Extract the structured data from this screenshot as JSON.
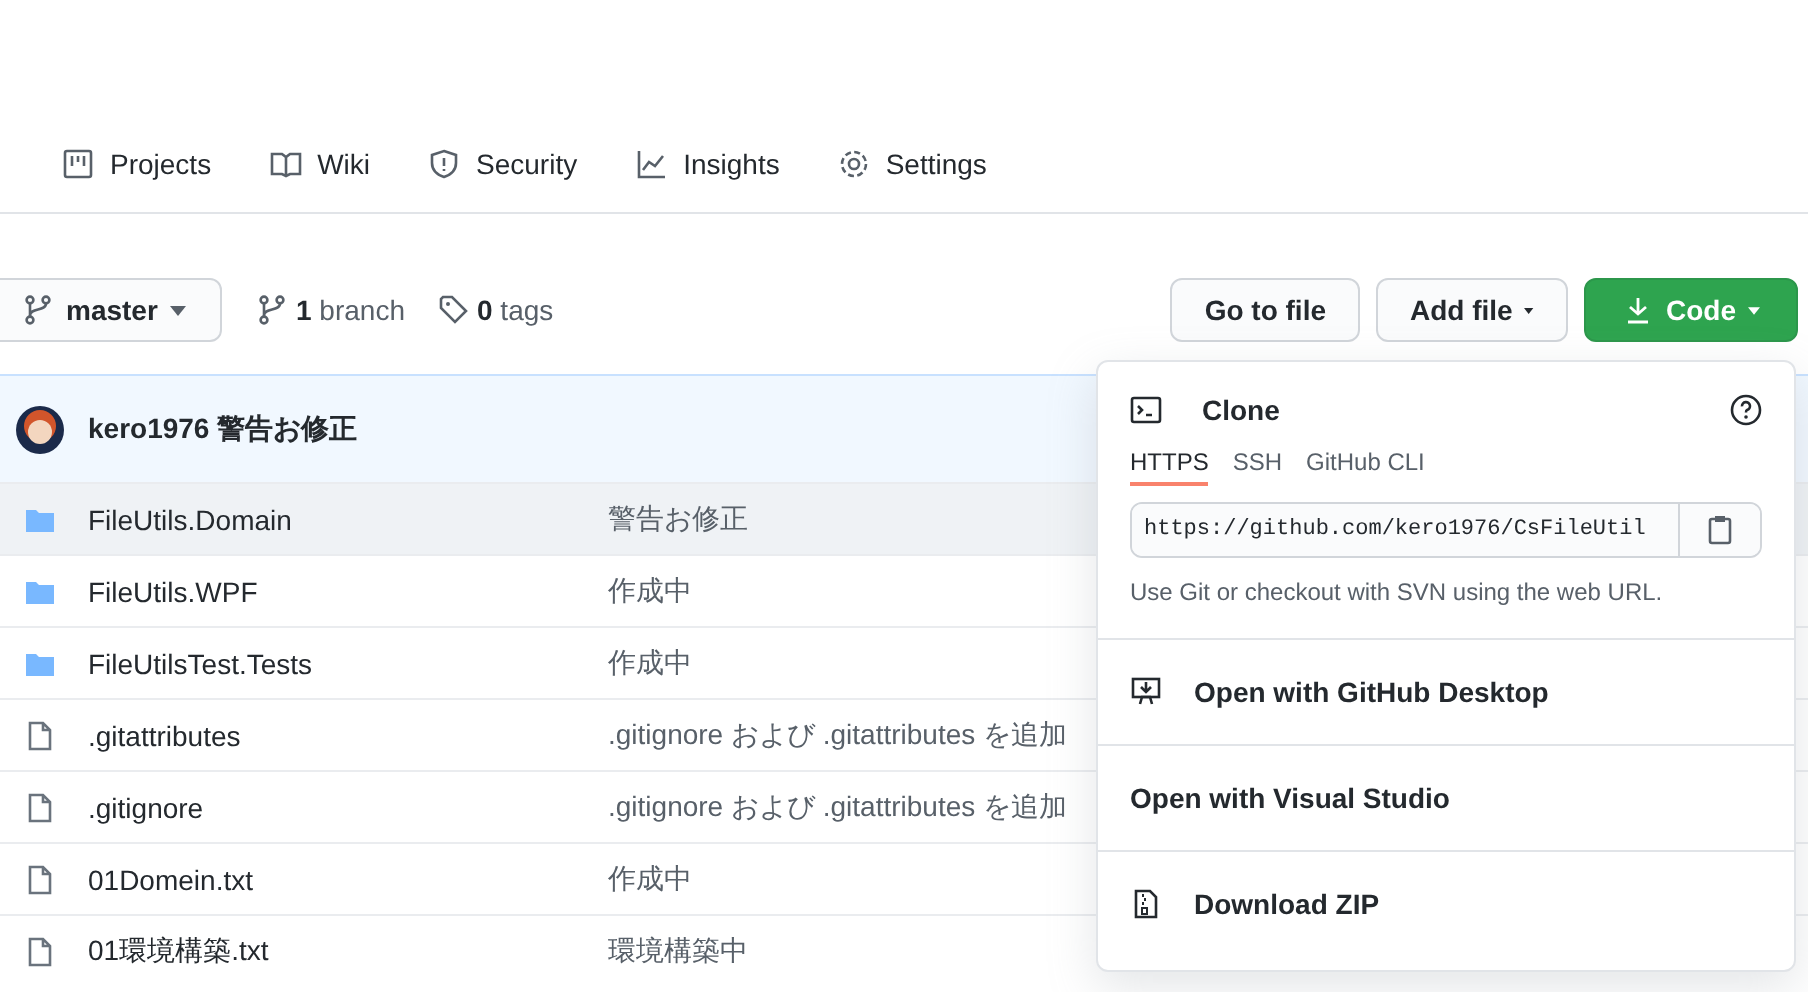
{
  "repo_nav": [
    {
      "label": "Projects",
      "selected": false
    },
    {
      "label": "Wiki",
      "selected": false
    },
    {
      "label": "Security",
      "selected": false
    },
    {
      "label": "Insights",
      "selected": false
    },
    {
      "label": "Settings",
      "selected": false
    }
  ],
  "branch_button": {
    "label": "master"
  },
  "branch_count": {
    "count": "1",
    "label": "branch"
  },
  "tag_count": {
    "count": "0",
    "label": "tags"
  },
  "actions": [
    {
      "label": "Go to file",
      "kind": "plain"
    },
    {
      "label": "Add file",
      "kind": "menu"
    },
    {
      "label": "Code",
      "kind": "primary"
    }
  ],
  "latest_commit": {
    "author": "kero1976",
    "message": "警告お修正"
  },
  "files": [
    {
      "kind": "folder",
      "name": "FileUtils.Domain",
      "message": "警告お修正",
      "selected": true
    },
    {
      "kind": "folder",
      "name": "FileUtils.WPF",
      "message": "作成中",
      "selected": false
    },
    {
      "kind": "folder",
      "name": "FileUtilsTest.Tests",
      "message": "作成中",
      "selected": false
    },
    {
      "kind": "file",
      "name": ".gitattributes",
      "message": ".gitignore および .gitattributes を追加",
      "selected": false
    },
    {
      "kind": "file",
      "name": ".gitignore",
      "message": ".gitignore および .gitattributes を追加",
      "selected": false
    },
    {
      "kind": "file",
      "name": "01Domein.txt",
      "message": "作成中",
      "selected": false
    },
    {
      "kind": "file",
      "name": "01環境構築.txt",
      "message": "環境構築中",
      "selected": false
    }
  ],
  "code_menu": {
    "title": "Clone",
    "tabs": [
      {
        "label": "HTTPS",
        "selected": true
      },
      {
        "label": "SSH",
        "selected": false
      },
      {
        "label": "GitHub CLI",
        "selected": false
      }
    ],
    "url": "https://github.com/kero1976/CsFileUtil",
    "hint": "Use Git or checkout with SVN using the web URL.",
    "items": [
      {
        "label": "Open with GitHub Desktop"
      },
      {
        "label": "Open with Visual Studio"
      },
      {
        "label": "Download ZIP"
      }
    ]
  }
}
